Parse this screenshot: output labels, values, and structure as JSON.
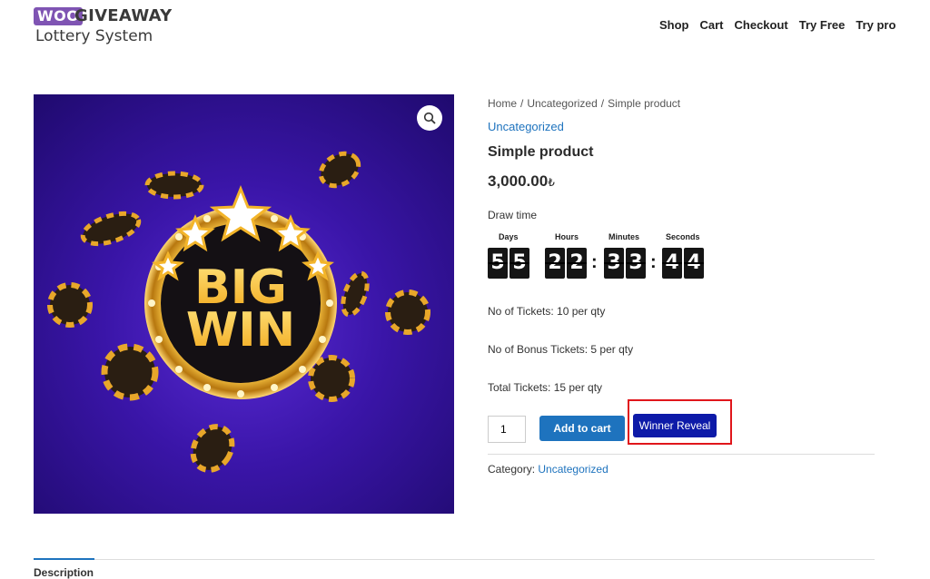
{
  "header": {
    "logo": {
      "woo": "WOO",
      "giveaway": "GIVEAWAY",
      "lottery": "Lottery System"
    },
    "nav": [
      "Shop",
      "Cart",
      "Checkout",
      "Try Free",
      "Try pro"
    ]
  },
  "product_image": {
    "text_line1": "BIG",
    "text_line2": "WIN",
    "zoom_icon": "magnifier-icon"
  },
  "summary": {
    "breadcrumb": [
      "Home",
      "Uncategorized",
      "Simple product"
    ],
    "breadcrumb_sep": "/",
    "category_link": "Uncategorized",
    "title": "Simple product",
    "price": "3,000.00",
    "currency": "₺",
    "draw_label": "Draw time",
    "countdown": {
      "days_label": "Days",
      "hours_label": "Hours",
      "minutes_label": "Minutes",
      "seconds_label": "Seconds",
      "d1": "5",
      "d2": "5",
      "h1": "2",
      "h2": "2",
      "m1": "3",
      "m2": "3",
      "s1": "4",
      "s2": "4",
      "colon": ":"
    },
    "tickets": "No of Tickets: 10 per qty",
    "bonus": "No of Bonus Tickets: 5 per qty",
    "total": "Total Tickets: 15 per qty",
    "qty_value": "1",
    "add_to_cart": "Add to cart",
    "winner_reveal": "Winner Reveal",
    "category_label": "Category:",
    "category_value": "Uncategorized"
  },
  "tabs": {
    "description": "Description"
  },
  "colors": {
    "link": "#1e73be",
    "reveal_button": "#0d1aa8",
    "highlight": "#e0161b"
  }
}
